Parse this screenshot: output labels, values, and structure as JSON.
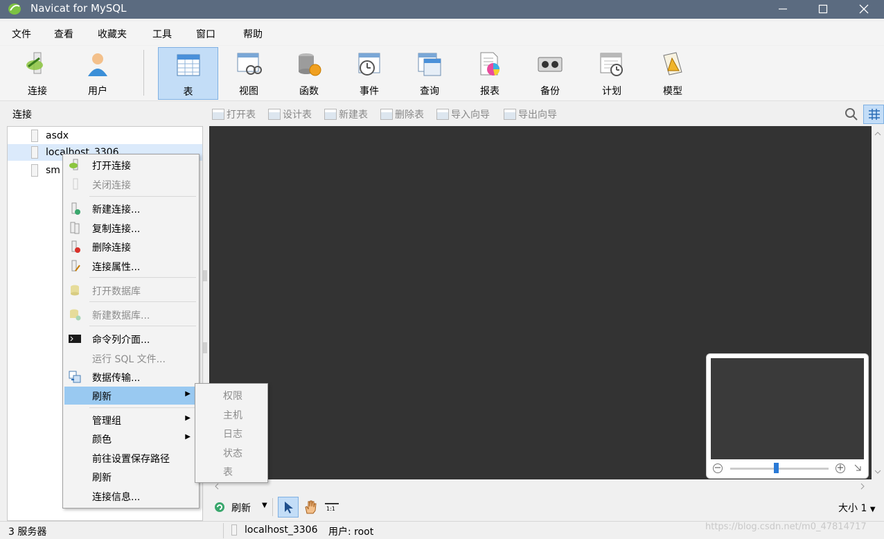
{
  "window": {
    "title": "Navicat for MySQL",
    "minimize": "—",
    "maximize": "☐",
    "close": "✕"
  },
  "menubar": [
    "文件",
    "查看",
    "收藏夹",
    "工具",
    "窗口",
    "帮助"
  ],
  "toolbar": [
    {
      "label": "连接",
      "icon": "connection-icon"
    },
    {
      "label": "用户",
      "icon": "user-icon"
    },
    {
      "label": "表",
      "icon": "table-icon",
      "active": true
    },
    {
      "label": "视图",
      "icon": "view-icon"
    },
    {
      "label": "函数",
      "icon": "function-icon"
    },
    {
      "label": "事件",
      "icon": "event-icon"
    },
    {
      "label": "查询",
      "icon": "query-icon"
    },
    {
      "label": "报表",
      "icon": "report-icon"
    },
    {
      "label": "备份",
      "icon": "backup-icon"
    },
    {
      "label": "计划",
      "icon": "schedule-icon"
    },
    {
      "label": "模型",
      "icon": "model-icon"
    }
  ],
  "subbar": {
    "section_label": "连接",
    "actions": [
      "打开表",
      "设计表",
      "新建表",
      "删除表",
      "导入向导",
      "导出向导"
    ]
  },
  "tree": {
    "items": [
      {
        "label": "asdx"
      },
      {
        "label": "localhost_3306",
        "selected": true
      },
      {
        "label": "sm"
      }
    ]
  },
  "context_menu": {
    "items": [
      {
        "label": "打开连接",
        "disabled": false,
        "icon": "open-connection-icon"
      },
      {
        "label": "关闭连接",
        "disabled": true,
        "icon": "close-connection-icon"
      },
      {
        "label": "新建连接...",
        "disabled": false,
        "icon": "new-connection-icon"
      },
      {
        "label": "复制连接...",
        "disabled": false,
        "icon": "copy-connection-icon"
      },
      {
        "label": "删除连接",
        "disabled": false,
        "icon": "delete-connection-icon"
      },
      {
        "label": "连接属性...",
        "disabled": false,
        "icon": "connection-properties-icon"
      },
      {
        "label": "打开数据库",
        "disabled": true,
        "icon": "open-database-icon"
      },
      {
        "label": "新建数据库...",
        "disabled": true,
        "icon": "new-database-icon"
      },
      {
        "label": "命令列介面...",
        "disabled": false,
        "icon": "console-icon"
      },
      {
        "label": "运行 SQL 文件...",
        "disabled": true,
        "icon": ""
      },
      {
        "label": "数据传输...",
        "disabled": false,
        "icon": "data-transfer-icon"
      },
      {
        "label": "刷新",
        "disabled": false,
        "highlighted": true,
        "submenu": true
      },
      {
        "label": "管理组",
        "disabled": false,
        "submenu": true
      },
      {
        "label": "颜色",
        "disabled": false,
        "submenu": true
      },
      {
        "label": "前往设置保存路径",
        "disabled": false
      },
      {
        "label": "刷新",
        "disabled": false
      },
      {
        "label": "连接信息...",
        "disabled": false
      }
    ]
  },
  "submenu": {
    "items": [
      "权限",
      "主机",
      "日志",
      "状态",
      "表"
    ]
  },
  "ctrlbar": {
    "refresh_label": "刷新",
    "size_label": "大小 1",
    "ratio_label": "1:1"
  },
  "statusbar": {
    "server_count": "3 服务器",
    "connection": "localhost_3306",
    "user": "用户: root",
    "watermark": "https://blog.csdn.net/m0_47814717"
  },
  "colors": {
    "titlebar": "#5b6b80",
    "canvas": "#333333",
    "menu_highlight": "#99c9f1",
    "toolbar_active": "#c3ddf7"
  }
}
